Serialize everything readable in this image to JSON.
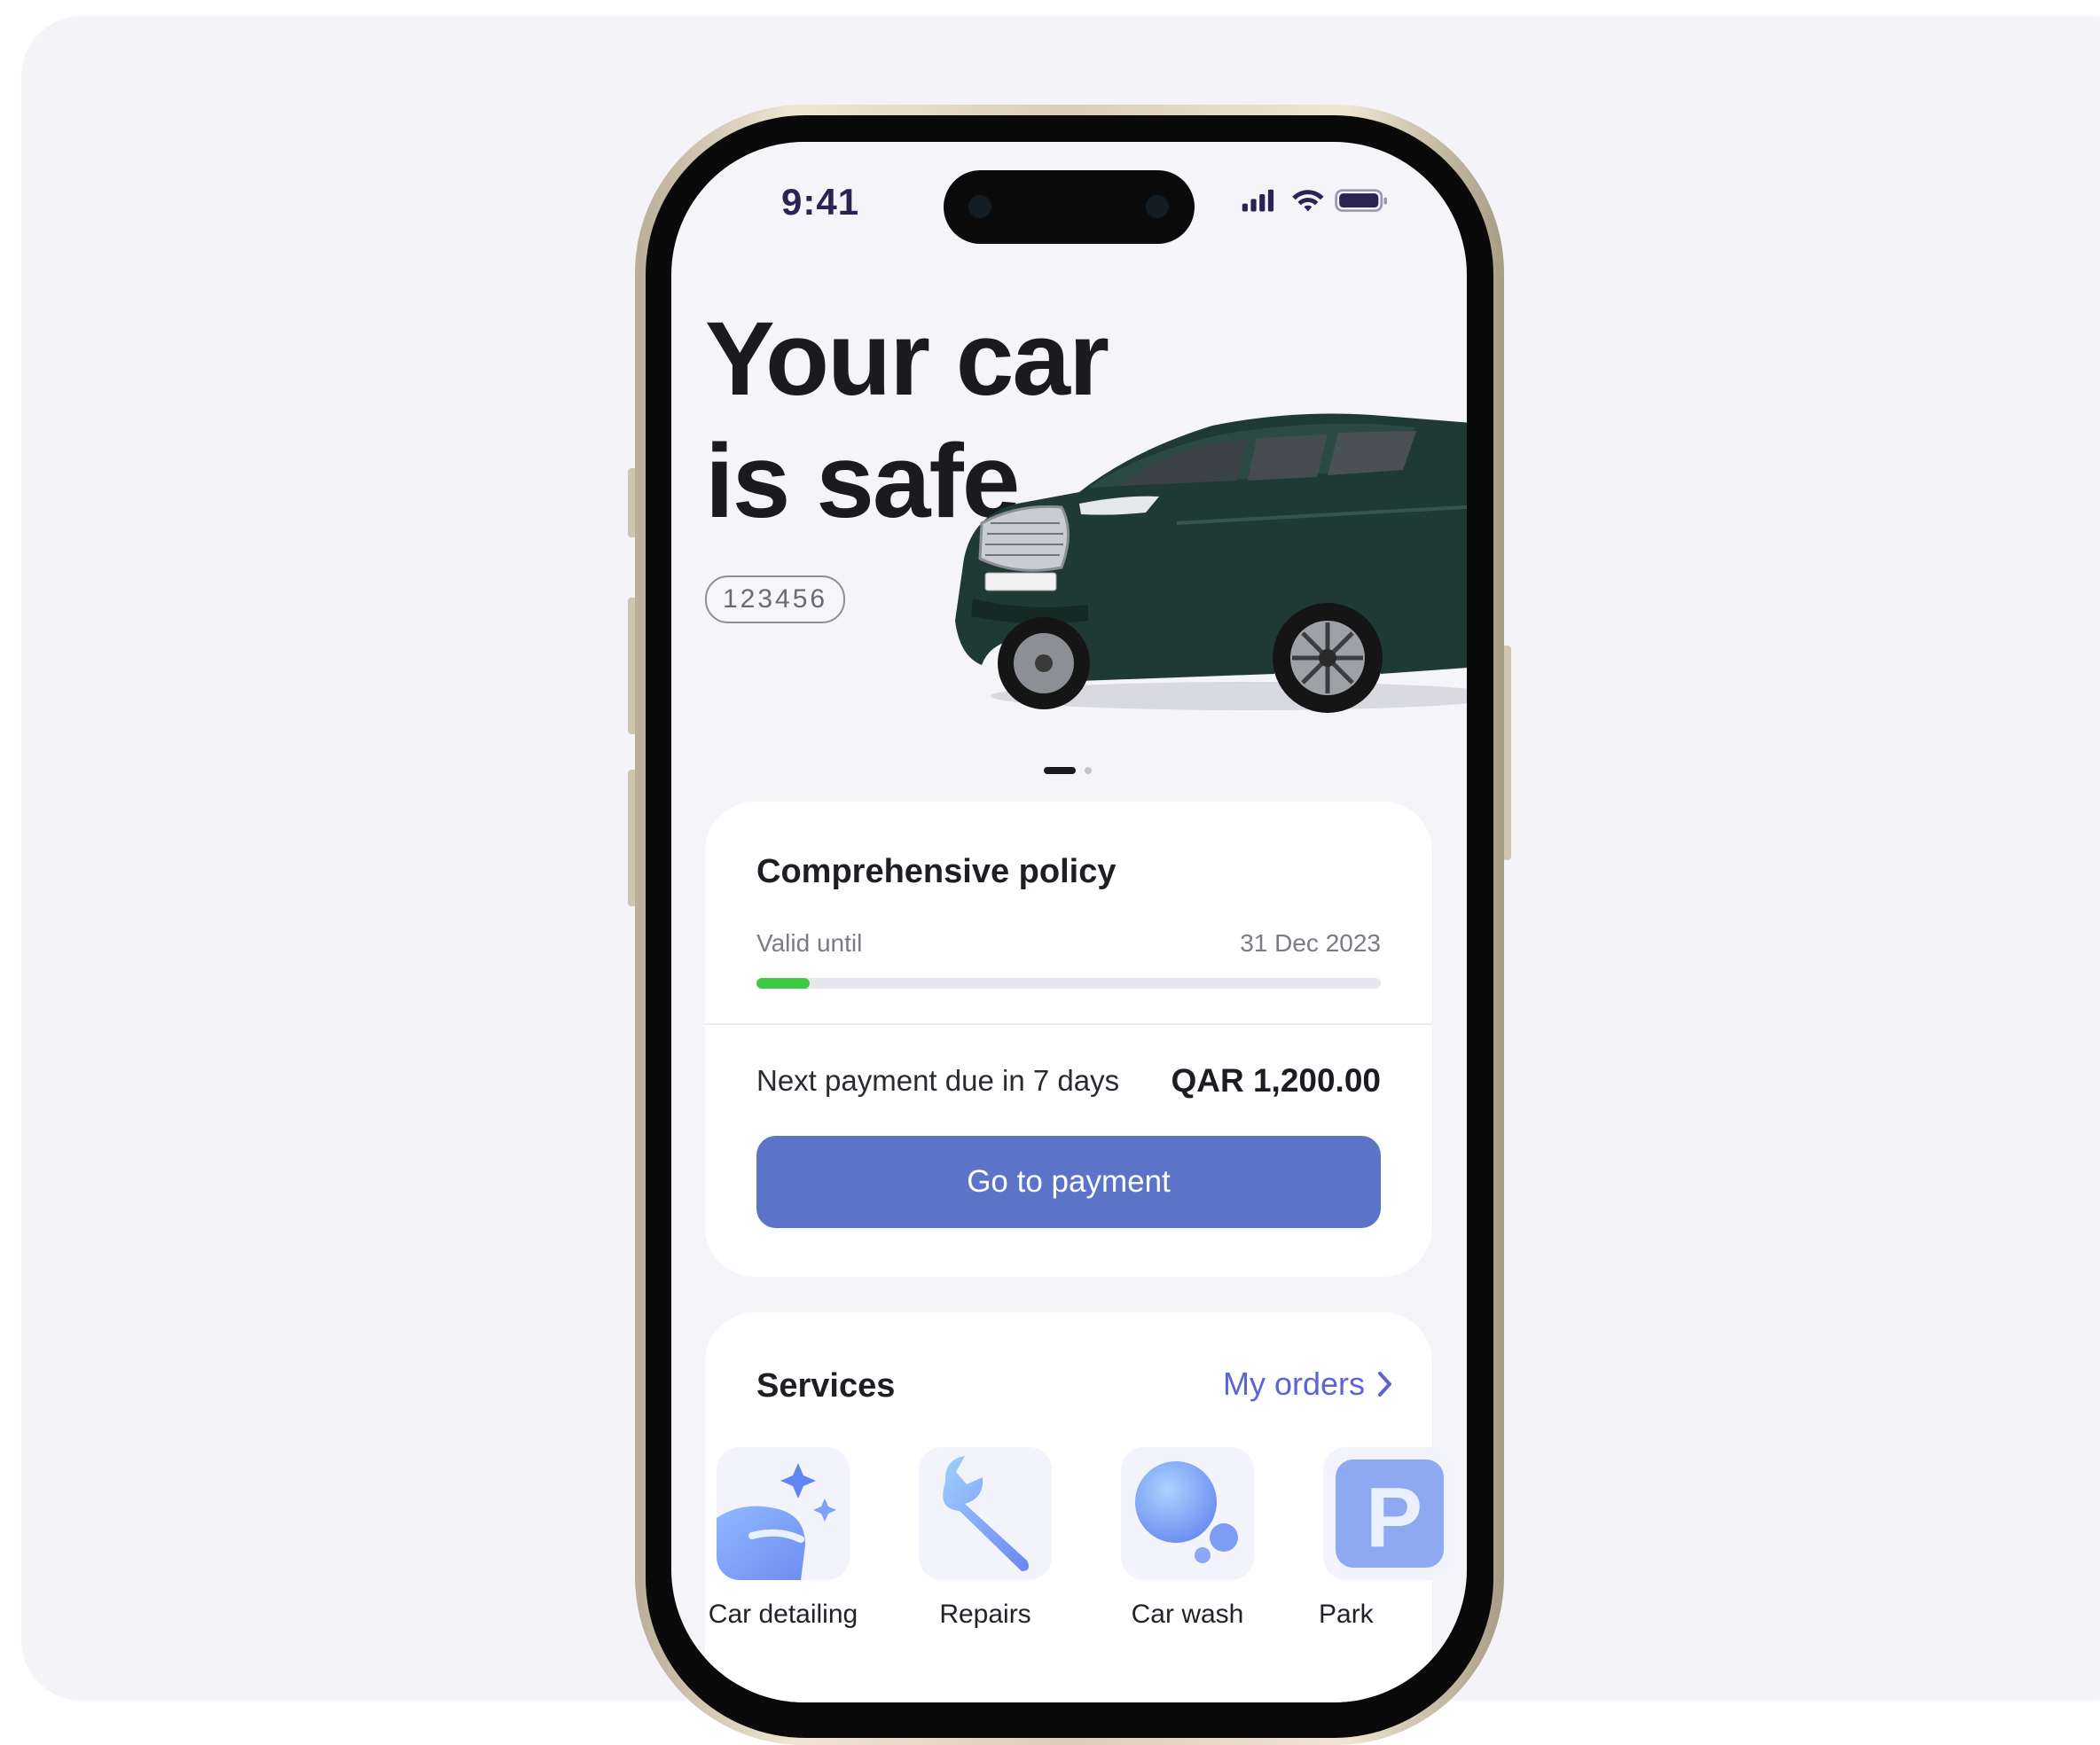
{
  "status_bar": {
    "time": "9:41"
  },
  "hero": {
    "title_line1": "Your car",
    "title_line2": "is safe",
    "plate_number": "123456"
  },
  "carousel": {
    "pages": 2,
    "active_page": 1
  },
  "policy": {
    "title": "Comprehensive policy",
    "valid_label": "Valid until",
    "valid_date": "31 Dec 2023",
    "progress_fraction": 0.085,
    "progress_color": "#3ecb43",
    "due_label": "Next payment due in 7 days",
    "amount": "QAR 1,200.00",
    "pay_button_label": "Go to payment"
  },
  "services": {
    "title": "Services",
    "orders_link": "My orders",
    "items": [
      {
        "label": "Car detailing",
        "icon": "car-detailing-icon"
      },
      {
        "label": "Repairs",
        "icon": "wrench-icon"
      },
      {
        "label": "Car wash",
        "icon": "bubbles-icon"
      },
      {
        "label": "Park",
        "icon": "parking-icon"
      }
    ]
  },
  "colors": {
    "accent_button": "#5b74c8",
    "link": "#5b63d6",
    "car_body": "#1f3a34"
  }
}
